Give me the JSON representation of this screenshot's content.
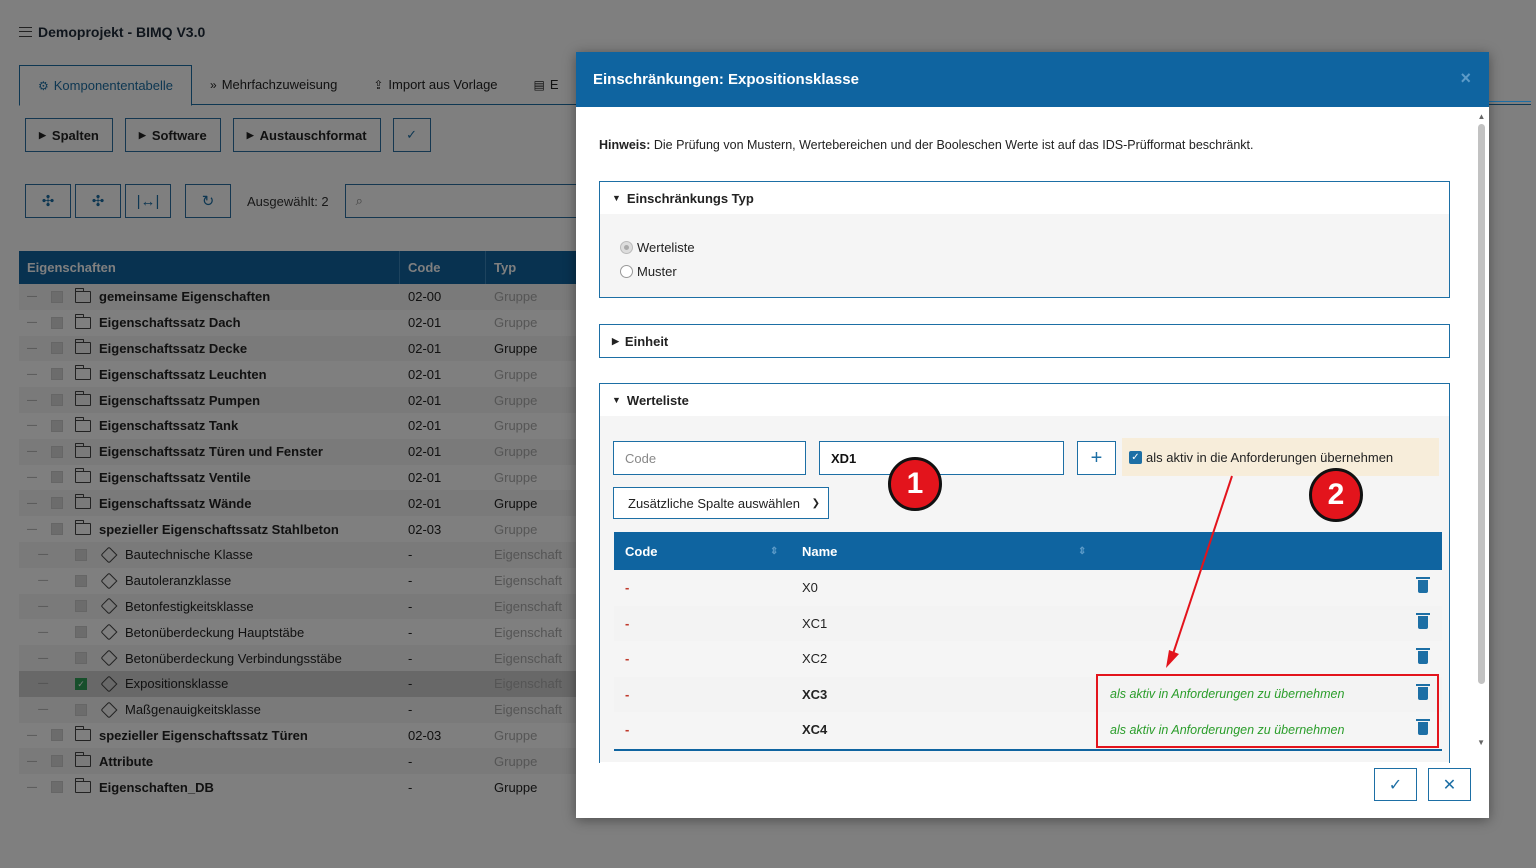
{
  "app": {
    "title": "Demoprojekt - BIMQ V3.0",
    "tabs": [
      {
        "label": "Komponententabelle",
        "glyph": "⚙"
      },
      {
        "label": "Mehrfachzuweisung",
        "glyph": "»"
      },
      {
        "label": "Import aus Vorlage",
        "glyph": "⇪"
      },
      {
        "label": "E",
        "glyph": "▤"
      }
    ],
    "toolbar": {
      "spalten": "Spalten",
      "software": "Software",
      "austauschformat": "Austauschformat",
      "confirm_glyph": "✓"
    },
    "tools": {
      "expand_glyph": "✣",
      "collapse_glyph": "✣",
      "width_glyph": "|↔|",
      "reset_glyph": "↻",
      "selected_label": "Ausgewählt: 2",
      "search_glyph": "⌕"
    },
    "grid": {
      "headers": [
        "Eigenschaften",
        "Code",
        "Typ"
      ],
      "rows": [
        {
          "name": "gemeinsame Eigenschaften",
          "code": "02-00",
          "type": "Gruppe",
          "level": 1,
          "icon": "folder-icon",
          "typeMuted": true
        },
        {
          "name": "Eigenschaftssatz Dach",
          "code": "02-01",
          "type": "Gruppe",
          "level": 1,
          "icon": "folder-icon",
          "typeMuted": true
        },
        {
          "name": "Eigenschaftssatz Decke",
          "code": "02-01",
          "type": "Gruppe",
          "level": 1,
          "icon": "folder-icon",
          "typeMuted": false
        },
        {
          "name": "Eigenschaftssatz Leuchten",
          "code": "02-01",
          "type": "Gruppe",
          "level": 1,
          "icon": "folder-icon",
          "typeMuted": true
        },
        {
          "name": "Eigenschaftssatz Pumpen",
          "code": "02-01",
          "type": "Gruppe",
          "level": 1,
          "icon": "folder-icon",
          "typeMuted": true
        },
        {
          "name": "Eigenschaftssatz Tank",
          "code": "02-01",
          "type": "Gruppe",
          "level": 1,
          "icon": "folder-icon",
          "typeMuted": true
        },
        {
          "name": "Eigenschaftssatz Türen und Fenster",
          "code": "02-01",
          "type": "Gruppe",
          "level": 1,
          "icon": "folder-icon",
          "typeMuted": true
        },
        {
          "name": "Eigenschaftssatz Ventile",
          "code": "02-01",
          "type": "Gruppe",
          "level": 1,
          "icon": "folder-icon",
          "typeMuted": true
        },
        {
          "name": "Eigenschaftssatz Wände",
          "code": "02-01",
          "type": "Gruppe",
          "level": 1,
          "icon": "folder-icon",
          "typeMuted": false
        },
        {
          "name": "spezieller Eigenschaftssatz Stahlbeton",
          "code": "02-03",
          "type": "Gruppe",
          "level": 1,
          "icon": "folder-icon",
          "typeMuted": true
        },
        {
          "name": "Bautechnische Klasse",
          "code": "-",
          "type": "Eigenschaft",
          "level": 2,
          "icon": "tag-icon",
          "typeMuted": true
        },
        {
          "name": "Bautoleranzklasse",
          "code": "-",
          "type": "Eigenschaft",
          "level": 2,
          "icon": "tag-icon",
          "typeMuted": true
        },
        {
          "name": "Betonfestigkeitsklasse",
          "code": "-",
          "type": "Eigenschaft",
          "level": 2,
          "icon": "tag-icon",
          "typeMuted": true
        },
        {
          "name": "Betonüberdeckung Hauptstäbe",
          "code": "-",
          "type": "Eigenschaft",
          "level": 2,
          "icon": "tag-icon",
          "typeMuted": true
        },
        {
          "name": "Betonüberdeckung Verbindungsstäbe",
          "code": "-",
          "type": "Eigenschaft",
          "level": 2,
          "icon": "tag-icon",
          "typeMuted": true
        },
        {
          "name": "Expositionsklasse",
          "code": "-",
          "type": "Eigenschaft",
          "level": 2,
          "icon": "tag-icon",
          "typeMuted": true,
          "selected": true
        },
        {
          "name": "Maßgenauigkeitsklasse",
          "code": "-",
          "type": "Eigenschaft",
          "level": 2,
          "icon": "tag-icon",
          "typeMuted": true
        },
        {
          "name": "spezieller Eigenschaftssatz Türen",
          "code": "02-03",
          "type": "Gruppe",
          "level": 1,
          "icon": "folder-icon",
          "typeMuted": true
        },
        {
          "name": "Attribute",
          "code": "-",
          "type": "Gruppe",
          "level": 1,
          "icon": "folder-icon",
          "typeMuted": true
        },
        {
          "name": "Eigenschaften_DB",
          "code": "-",
          "type": "Gruppe",
          "level": 1,
          "icon": "folder-icon",
          "typeMuted": false
        }
      ]
    }
  },
  "modal": {
    "title": "Einschränkungen: Expositionsklasse",
    "close_glyph": "×",
    "hint_label": "Hinweis:",
    "hint_text": " Die Prüfung von Mustern, Wertebereichen und der Booleschen Werte ist auf das IDS-Prüfformat beschränkt.",
    "type_section": {
      "title": "Einschränkungs Typ",
      "options": [
        {
          "label": "Werteliste",
          "checked": true
        },
        {
          "label": "Muster",
          "checked": false
        }
      ]
    },
    "unit_section": {
      "title": "Einheit"
    },
    "list_section": {
      "title": "Werteliste",
      "code_placeholder": "Code",
      "name_value": "XD1",
      "add_glyph": "+",
      "aktiv_label": "als aktiv in die Anforderungen übernehmen",
      "column_select": "Zusätzliche Spalte auswählen",
      "table": {
        "headers": [
          "Code",
          "Name"
        ],
        "sort_glyph": "⇕",
        "rows": [
          {
            "code": "-",
            "name": "X0",
            "note": ""
          },
          {
            "code": "-",
            "name": "XC1",
            "note": ""
          },
          {
            "code": "-",
            "name": "XC2",
            "note": ""
          },
          {
            "code": "-",
            "name": "XC3",
            "note": "als aktiv in Anforderungen zu übernehmen"
          },
          {
            "code": "-",
            "name": "XC4",
            "note": "als aktiv in Anforderungen zu übernehmen"
          }
        ]
      }
    },
    "footer": {
      "ok_glyph": "✓",
      "cancel_glyph": "✕"
    },
    "markers": [
      "1",
      "2"
    ]
  },
  "colors": {
    "brand": "#0f64a0",
    "annotation": "#e3141c",
    "active_note": "#2a9d2a"
  }
}
